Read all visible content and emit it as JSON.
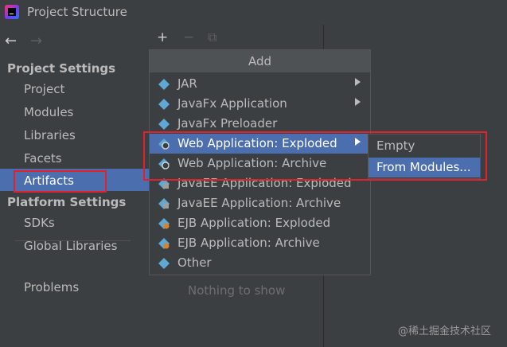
{
  "window": {
    "title": "Project Structure"
  },
  "nav": {
    "back": "←",
    "forward": "→"
  },
  "sidebar": {
    "project_settings": "Project Settings",
    "project_items": [
      "Project",
      "Modules",
      "Libraries",
      "Facets",
      "Artifacts"
    ],
    "platform_settings": "Platform Settings",
    "platform_items": [
      "SDKs",
      "Global Libraries"
    ],
    "problems": "Problems"
  },
  "toolbar": {
    "add": "+",
    "remove": "−",
    "copy": "⧉"
  },
  "main": {
    "empty_text": "Nothing to show"
  },
  "popup": {
    "title": "Add",
    "items": [
      {
        "label": "JAR",
        "icon": "jar-icon",
        "has_submenu": true
      },
      {
        "label": "JavaFx Application",
        "icon": "javafx-icon",
        "has_submenu": true
      },
      {
        "label": "JavaFx Preloader",
        "icon": "javafx-icon",
        "has_submenu": false
      },
      {
        "label": "Web Application: Exploded",
        "icon": "web-app-icon",
        "has_submenu": true,
        "highlighted": true
      },
      {
        "label": "Web Application: Archive",
        "icon": "web-app-icon",
        "has_submenu": false
      },
      {
        "label": "JavaEE Application: Exploded",
        "icon": "javaee-icon",
        "has_submenu": false
      },
      {
        "label": "JavaEE Application: Archive",
        "icon": "javaee-icon",
        "has_submenu": false
      },
      {
        "label": "EJB Application: Exploded",
        "icon": "ejb-icon",
        "has_submenu": false
      },
      {
        "label": "EJB Application: Archive",
        "icon": "ejb-icon",
        "has_submenu": false
      },
      {
        "label": "Other",
        "icon": "other-icon",
        "has_submenu": false
      }
    ]
  },
  "submenu": {
    "items": [
      {
        "label": "Empty"
      },
      {
        "label": "From Modules..."
      }
    ]
  },
  "watermark": "@稀土掘金技术社区",
  "colors": {
    "selection": "#4b6eaf",
    "background": "#3c3f41",
    "annotation": "#e0202a"
  }
}
